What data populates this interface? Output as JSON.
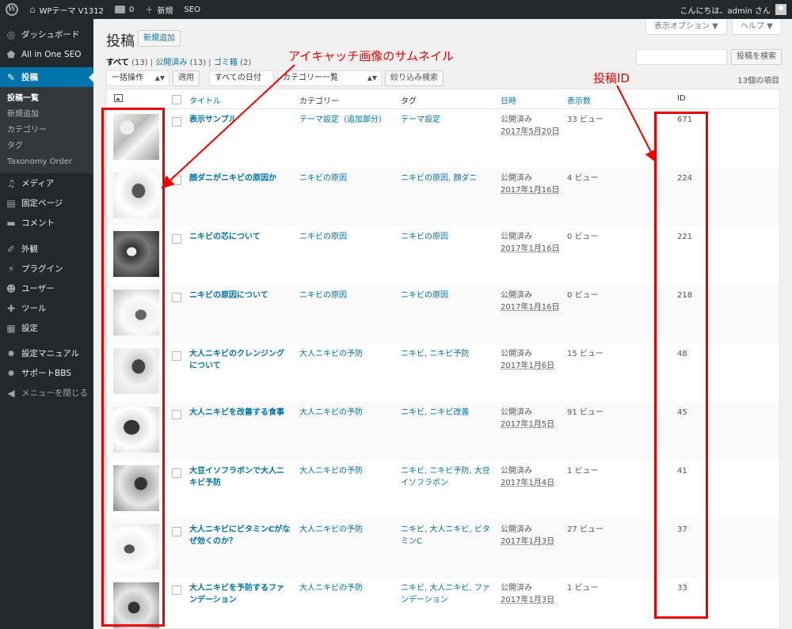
{
  "adminbar": {
    "site_name": "WPテーマ V1312",
    "comments_count": "0",
    "new_label": "新規",
    "seo_label": "SEO",
    "greeting": "こんにちは、admin さん"
  },
  "sidebar": {
    "items": [
      {
        "label": "ダッシュボード",
        "icon": "dashboard-icon",
        "glyph": "◎"
      },
      {
        "label": "All in One SEO",
        "icon": "shield-icon",
        "glyph": "⬟"
      },
      {
        "label": "投稿",
        "icon": "pin-icon",
        "glyph": "✎"
      },
      {
        "label": "メディア",
        "icon": "media-icon",
        "glyph": "♫"
      },
      {
        "label": "固定ページ",
        "icon": "page-icon",
        "glyph": "▤"
      },
      {
        "label": "コメント",
        "icon": "comment-icon",
        "glyph": "▬"
      },
      {
        "label": "外観",
        "icon": "brush-icon",
        "glyph": "✐"
      },
      {
        "label": "プラグイン",
        "icon": "plugin-icon",
        "glyph": "⚡"
      },
      {
        "label": "ユーザー",
        "icon": "user-icon",
        "glyph": "☻"
      },
      {
        "label": "ツール",
        "icon": "wrench-icon",
        "glyph": "✚"
      },
      {
        "label": "設定",
        "icon": "settings-icon",
        "glyph": "▦"
      },
      {
        "label": "設定マニュアル",
        "icon": "gear-icon",
        "glyph": "✹"
      },
      {
        "label": "サポートBBS",
        "icon": "gear-icon",
        "glyph": "✹"
      },
      {
        "label": "メニューを閉じる",
        "icon": "collapse-icon",
        "glyph": "◀"
      }
    ],
    "submenu": [
      "投稿一覧",
      "新規追加",
      "カテゴリー",
      "タグ",
      "Taxonomy Order"
    ]
  },
  "header": {
    "title": "投稿",
    "add_new": "新規追加",
    "screen_options": "表示オプション ▼",
    "help": "ヘルプ ▼"
  },
  "views": {
    "all": "すべて",
    "all_count": "(13)",
    "published": "公開済み",
    "published_count": "(13)",
    "trash": "ゴミ箱",
    "trash_count": "(2)",
    "sep": "|"
  },
  "search": {
    "button": "投稿を検索",
    "placeholder": ""
  },
  "filters": {
    "bulk": "一括操作",
    "apply": "適用",
    "all_dates": "すべての日付",
    "category": "カテゴリー一覧",
    "filter": "絞り込み検索",
    "items_count": "13個の項目"
  },
  "table": {
    "columns": {
      "title": "タイトル",
      "category": "カテゴリー",
      "tag": "タグ",
      "date": "日時",
      "views": "表示数",
      "id": "ID"
    },
    "rows": [
      {
        "title": "表示サンプル",
        "category": "テーマ設定（追加部分）",
        "tags": "テーマ設定",
        "status": "公開済み",
        "date": "2017年5月20日",
        "views": "33 ビュー",
        "id": "671"
      },
      {
        "title": "顔ダニがニキビの原因か",
        "category": "ニキビの原因",
        "tags": "ニキビの原因, 顔ダニ",
        "status": "公開済み",
        "date": "2017年1月16日",
        "views": "4 ビュー",
        "id": "224"
      },
      {
        "title": "ニキビの芯について",
        "category": "ニキビの原因",
        "tags": "ニキビの原因",
        "status": "公開済み",
        "date": "2017年1月16日",
        "views": "0 ビュー",
        "id": "221"
      },
      {
        "title": "ニキビの原因について",
        "category": "ニキビの原因",
        "tags": "ニキビの原因",
        "status": "公開済み",
        "date": "2017年1月16日",
        "views": "0 ビュー",
        "id": "218"
      },
      {
        "title": "大人ニキビのクレンジングについて",
        "category": "大人ニキビの予防",
        "tags": "ニキビ, ニキビ予防",
        "status": "公開済み",
        "date": "2017年1月6日",
        "views": "15 ビュー",
        "id": "48"
      },
      {
        "title": "大人ニキビを改善する食事",
        "category": "大人ニキビの予防",
        "tags": "ニキビ, ニキビ改善",
        "status": "公開済み",
        "date": "2017年1月5日",
        "views": "91 ビュー",
        "id": "45"
      },
      {
        "title": "大豆イソフラボンで大人ニキビ予防",
        "category": "大人ニキビの予防",
        "tags": "ニキビ, ニキビ予防, 大豆イソフラボン",
        "status": "公開済み",
        "date": "2017年1月4日",
        "views": "1 ビュー",
        "id": "41"
      },
      {
        "title": "大人ニキビにビタミンCがなぜ効くのか？",
        "category": "大人ニキビの予防",
        "tags": "ニキビ, 大人ニキビ, ビタミンC",
        "status": "公開済み",
        "date": "2017年1月3日",
        "views": "27 ビュー",
        "id": "37"
      },
      {
        "title": "大人ニキビを予防するファンデーション",
        "category": "大人ニキビの予防",
        "tags": "ニキビ, 大人ニキビ, ファンデーション",
        "status": "公開済み",
        "date": "2017年1月3日",
        "views": "1 ビュー",
        "id": "33"
      }
    ]
  },
  "annotations": {
    "thumbnail_label": "アイキャッチ画像のサムネイル",
    "id_label": "投稿ID",
    "color": "#e00000"
  },
  "colors": {
    "accent": "#0073aa",
    "adminbar": "#23282d"
  }
}
